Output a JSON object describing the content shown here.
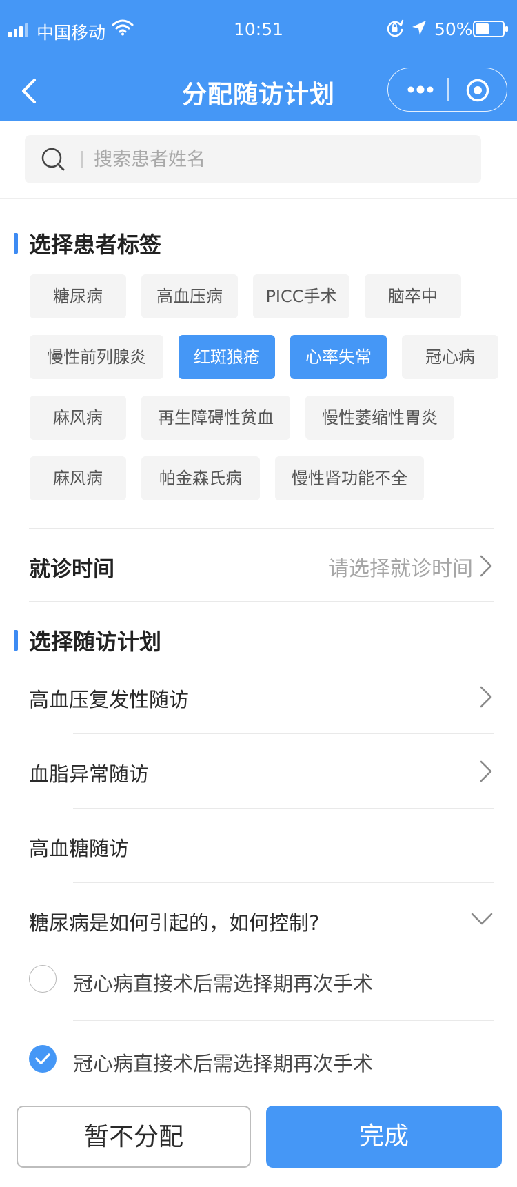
{
  "status_bar": {
    "carrier": "中国移动",
    "time": "10:51",
    "battery": "50%",
    "battery_level": 0.5
  },
  "nav": {
    "title": "分配随访计划"
  },
  "search": {
    "placeholder": "搜索患者姓名"
  },
  "tags_section": {
    "title": "选择患者标签"
  },
  "tags": [
    {
      "label": "糖尿病",
      "selected": false
    },
    {
      "label": "高血压病",
      "selected": false
    },
    {
      "label": "PICC手术",
      "selected": false
    },
    {
      "label": "脑卒中",
      "selected": false
    },
    {
      "label": "慢性前列腺炎",
      "selected": false
    },
    {
      "label": "红斑狼疮",
      "selected": true
    },
    {
      "label": "心率失常",
      "selected": true
    },
    {
      "label": "冠心病",
      "selected": false
    },
    {
      "label": "麻风病",
      "selected": false
    },
    {
      "label": "再生障碍性贫血",
      "selected": false
    },
    {
      "label": "慢性萎缩性胃炎",
      "selected": false
    },
    {
      "label": "麻风病",
      "selected": false
    },
    {
      "label": "帕金森氏病",
      "selected": false
    },
    {
      "label": "慢性肾功能不全",
      "selected": false
    }
  ],
  "visit_time": {
    "label": "就诊时间",
    "placeholder": "请选择就诊时间"
  },
  "plan_section": {
    "title": "选择随访计划"
  },
  "plans": [
    {
      "label": "高血压复发性随访"
    },
    {
      "label": "血脂异常随访"
    },
    {
      "label": "高血糖随访"
    },
    {
      "label": "糖尿病是如何引起的，如何控制?"
    }
  ],
  "plan_options": [
    {
      "label": "冠心病直接术后需选择期再次手术",
      "checked": false
    },
    {
      "label": "冠心病直接术后需选择期再次手术",
      "checked": true
    }
  ],
  "buttons": {
    "secondary": "暂不分配",
    "primary": "完成"
  },
  "colors": {
    "primary": "#4597f6",
    "tag_bg": "#f4f4f4",
    "divider": "#e9e9e9"
  }
}
